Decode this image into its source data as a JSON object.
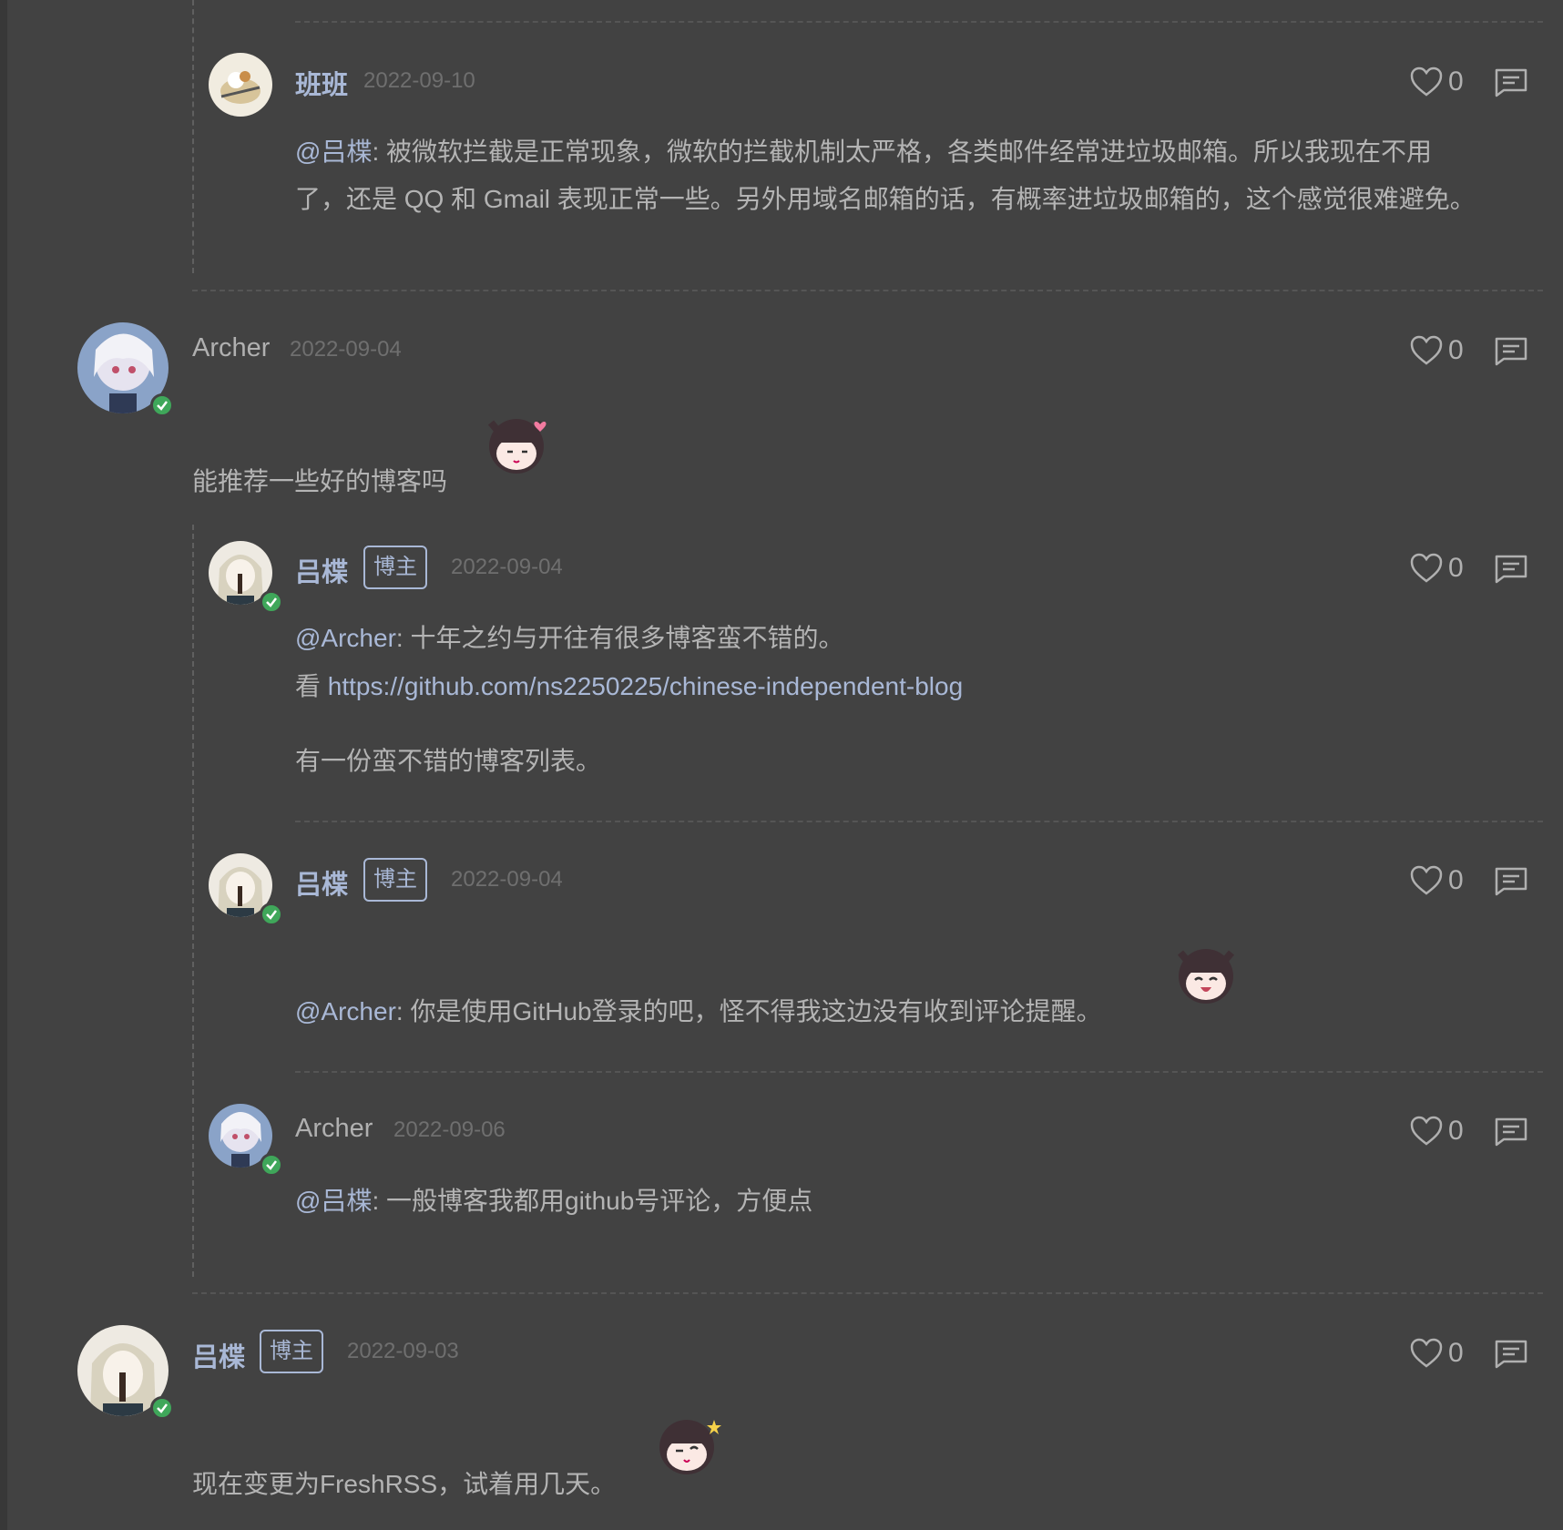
{
  "comments": [
    {
      "author": "班班",
      "date": "2022-09-10",
      "mention": "@吕楪",
      "text_line1": ": 被微软拦截是正常现象，微软的拦截机制太严格，各类邮件经常进垃圾邮箱。所以我现在不用",
      "text_line2": "了，还是 QQ 和 Gmail 表现正常一些。另外用域名邮箱的话，有概率进垃圾邮箱的，这个感觉很难避免。",
      "likes": "0"
    },
    {
      "author": "Archer",
      "date": "2022-09-04",
      "text": "能推荐一些好的博客吗",
      "likes": "0",
      "sticker": "cat-girl-heart-sticker"
    },
    {
      "author": "吕楪",
      "badge": "博主",
      "date": "2022-09-04",
      "mention": "@Archer",
      "text_line1": ": 十年之约与开往有很多博客蛮不错的。",
      "link_prefix": "看 ",
      "link": "https://github.com/ns2250225/chinese-independent-blog",
      "text_line3": "有一份蛮不错的博客列表。",
      "likes": "0"
    },
    {
      "author": "吕楪",
      "badge": "博主",
      "date": "2022-09-04",
      "mention": "@Archer",
      "text": ": 你是使用GitHub登录的吧，怪不得我这边没有收到评论提醒。",
      "likes": "0",
      "sticker": "cat-girl-laugh-sticker"
    },
    {
      "author": "Archer",
      "date": "2022-09-06",
      "mention": "@吕楪",
      "text": ": 一般博客我都用github号评论，方便点",
      "likes": "0"
    },
    {
      "author": "吕楪",
      "badge": "博主",
      "date": "2022-09-03",
      "text": "现在变更为FreshRSS，试着用几天。",
      "likes": "0",
      "sticker": "cat-girl-star-sticker"
    }
  ],
  "icons": {
    "like": "heart-icon",
    "reply": "reply-icon",
    "verified": "verified-check-icon"
  },
  "colors": {
    "background": "#424242",
    "author_accent": "#a9b8d6",
    "verified": "#3fa75a"
  }
}
